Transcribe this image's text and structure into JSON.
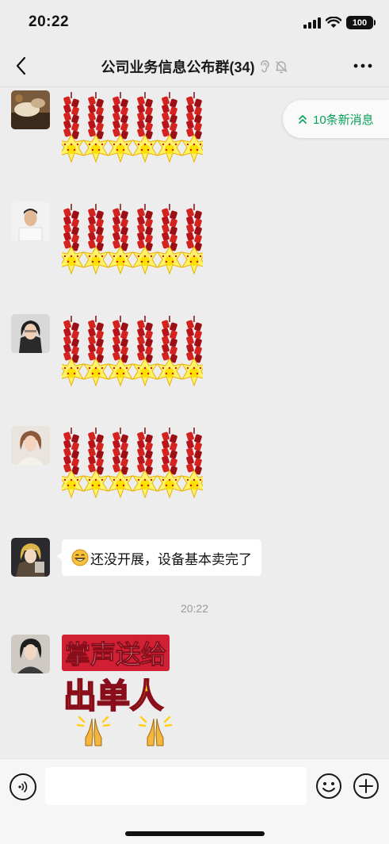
{
  "status_bar": {
    "time": "20:22",
    "battery": "100"
  },
  "nav": {
    "title": "公司业务信息公布群(34)"
  },
  "new_messages": {
    "label": "10条新消息"
  },
  "messages": [
    {
      "type": "sticker-firecrackers"
    },
    {
      "type": "sticker-firecrackers"
    },
    {
      "type": "sticker-firecrackers"
    },
    {
      "type": "sticker-firecrackers"
    },
    {
      "type": "text",
      "text": "还没开展，设备基本卖完了"
    },
    {
      "type": "sticker-text",
      "line1": "掌声送给",
      "line2": "出单人"
    }
  ],
  "timestamp": "20:22",
  "icons": [
    "back-chevron-icon",
    "earpiece-icon",
    "mute-bell-icon",
    "more-dots-icon",
    "double-chevron-up-icon",
    "voice-icon",
    "emoji-icon",
    "plus-icon",
    "grin-emoji-icon",
    "praying-hands-icon"
  ],
  "colors": {
    "background": "#ededed",
    "accent_green": "#07a05a",
    "bubble": "#ffffff"
  }
}
